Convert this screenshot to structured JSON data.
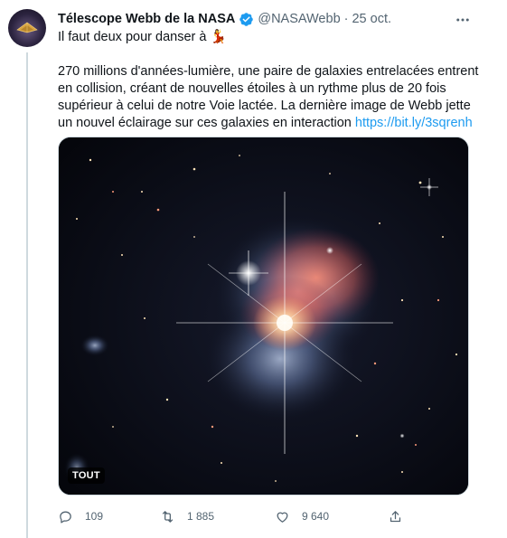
{
  "tweet": {
    "author": {
      "display_name": "Télescope Webb de la NASA",
      "handle": "@NASAWebb",
      "verified": true,
      "avatar_icon": "jwst-mirror-avatar"
    },
    "separator": "·",
    "date": "25 oct.",
    "text_first_line": "Il faut deux pour danser à ",
    "text_first_emoji": "💃",
    "text_body": "270 millions d'années-lumière, une paire de galaxies entrelacées entrent en collision, créant de nouvelles étoiles à un rythme plus de 20 fois supérieur à celui de notre Voie lactée. La dernière image de Webb jette un nouvel éclairage sur ces galaxies en interaction ",
    "link": "https://bit.ly/3sqrenh",
    "media": {
      "alt_badge": "TOUT",
      "image_description_icon": "interacting-galaxies-image"
    },
    "actions": {
      "reply_count": "109",
      "retweet_count": "1 885",
      "like_count": "9 640"
    }
  },
  "colors": {
    "accent": "#1d9bf0",
    "muted": "#536471",
    "text": "#0f1419"
  }
}
